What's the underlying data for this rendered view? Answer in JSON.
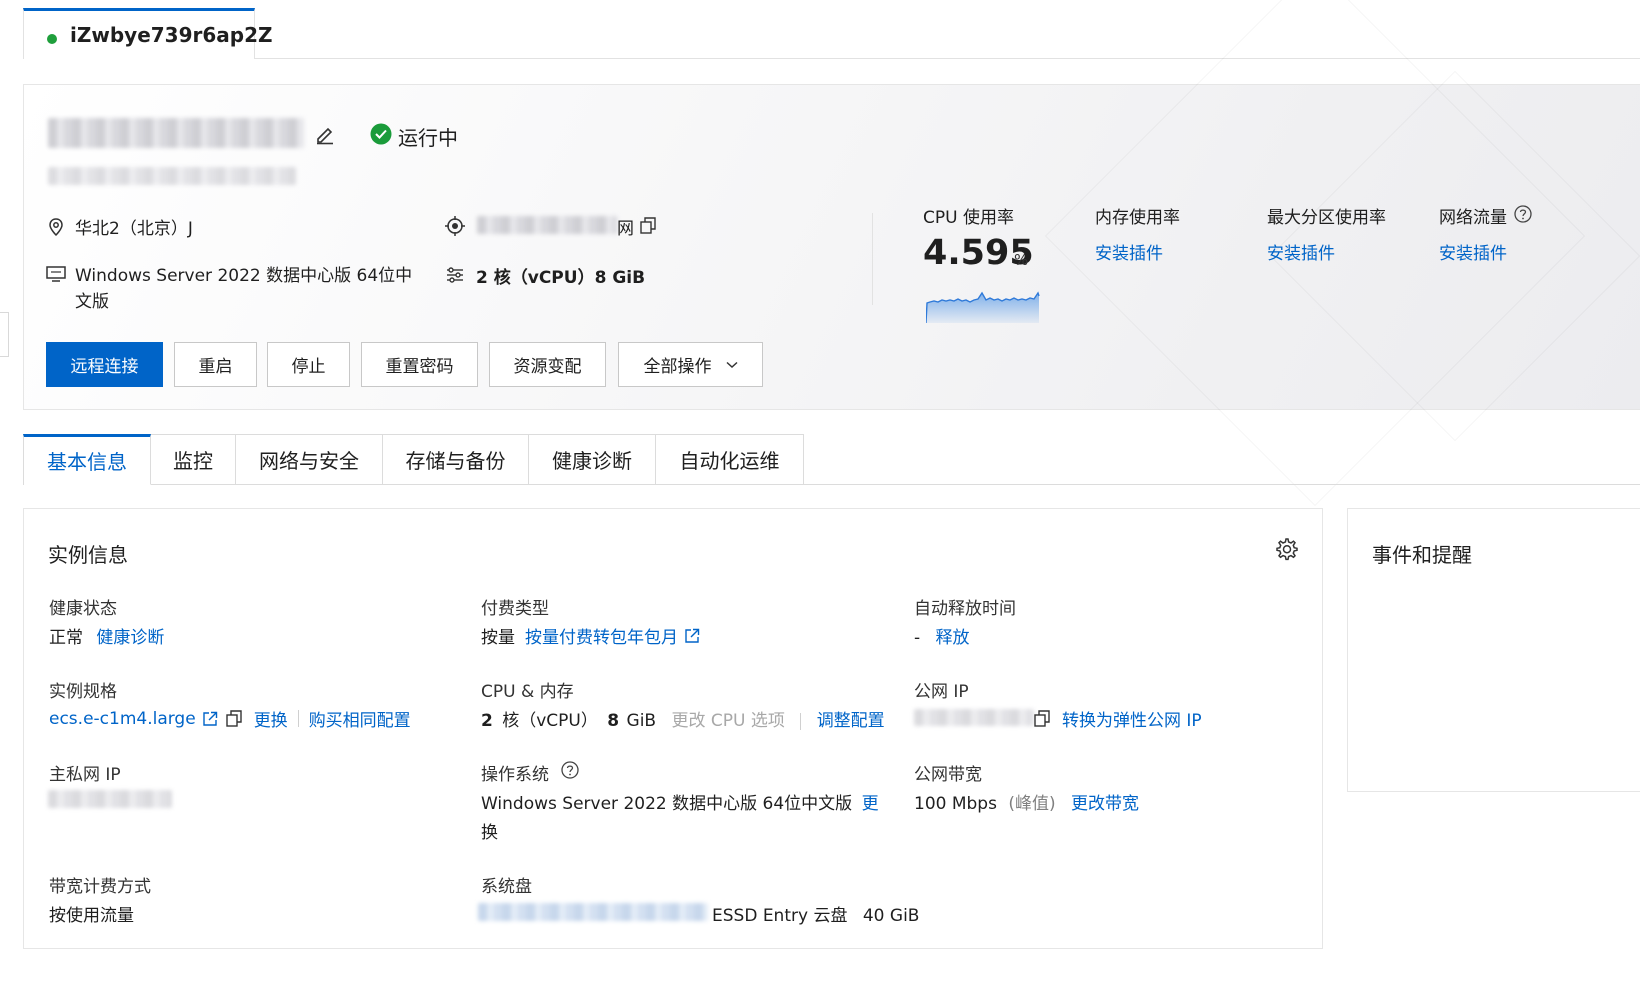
{
  "instance_tab": {
    "name": "iZwbye739r6ap2Z",
    "status_color": "#1f9f3c"
  },
  "hero": {
    "status": "运行中",
    "region": "华北2（北京）J",
    "ip_suffix": "网",
    "os": "Windows Server 2022 数据中心版 64位中文版",
    "spec": "2 核（vCPU）8 GiB",
    "buttons": {
      "remote": "远程连接",
      "restart": "重启",
      "stop": "停止",
      "reset_password": "重置密码",
      "resize": "资源变配",
      "all_actions": "全部操作"
    },
    "metrics": {
      "cpu_title": "CPU 使用率",
      "cpu_value": "4.595",
      "cpu_unit": "%",
      "mem_title": "内存使用率",
      "mem_link": "安装插件",
      "disk_title": "最大分区使用率",
      "disk_link": "安装插件",
      "net_title": "网络流量",
      "net_link": "安装插件"
    }
  },
  "tabs": [
    "基本信息",
    "监控",
    "网络与安全",
    "存储与备份",
    "健康诊断",
    "自动化运维"
  ],
  "instance_info": {
    "title": "实例信息",
    "health_label": "健康状态",
    "health_value": "正常",
    "health_link": "健康诊断",
    "billing_label": "付费类型",
    "billing_value": "按量",
    "billing_link": "按量付费转包年包月",
    "release_label": "自动释放时间",
    "release_value": "-",
    "release_link": "释放",
    "spec_label": "实例规格",
    "spec_value": "ecs.e-c1m4.large",
    "spec_change": "更换",
    "spec_buy": "购买相同配置",
    "cpu_mem_label": "CPU & 内存",
    "cpu_count": "2",
    "cpu_text": "核（vCPU）",
    "mem_value": "8",
    "mem_unit": "GiB",
    "cpu_option": "更改 CPU 选项",
    "adjust": "调整配置",
    "public_ip_label": "公网 IP",
    "public_ip_link": "转换为弹性公网 IP",
    "private_ip_label": "主私网 IP",
    "os_label": "操作系统",
    "os_value": "Windows Server 2022 数据中心版 64位中文版",
    "os_change_1": "更",
    "os_change_2": "换",
    "bandwidth_label": "公网带宽",
    "bandwidth_value": "100 Mbps",
    "bandwidth_peak": "(峰值)",
    "bandwidth_change": "更改带宽",
    "bw_billing_label": "带宽计费方式",
    "bw_billing_value": "按使用流量",
    "system_disk_label": "系统盘",
    "system_disk_type": "ESSD Entry 云盘",
    "system_disk_size": "40 GiB"
  },
  "events": {
    "title": "事件和提醒"
  },
  "colors": {
    "accent": "#0064c8",
    "running": "#1a9b3a"
  },
  "icons": [
    "edit-icon",
    "check-circle-icon",
    "location-icon",
    "target-icon",
    "copy-icon",
    "monitor-icon",
    "sliders-icon",
    "chevron-down-icon",
    "help-icon",
    "gear-icon",
    "external-link-icon"
  ]
}
